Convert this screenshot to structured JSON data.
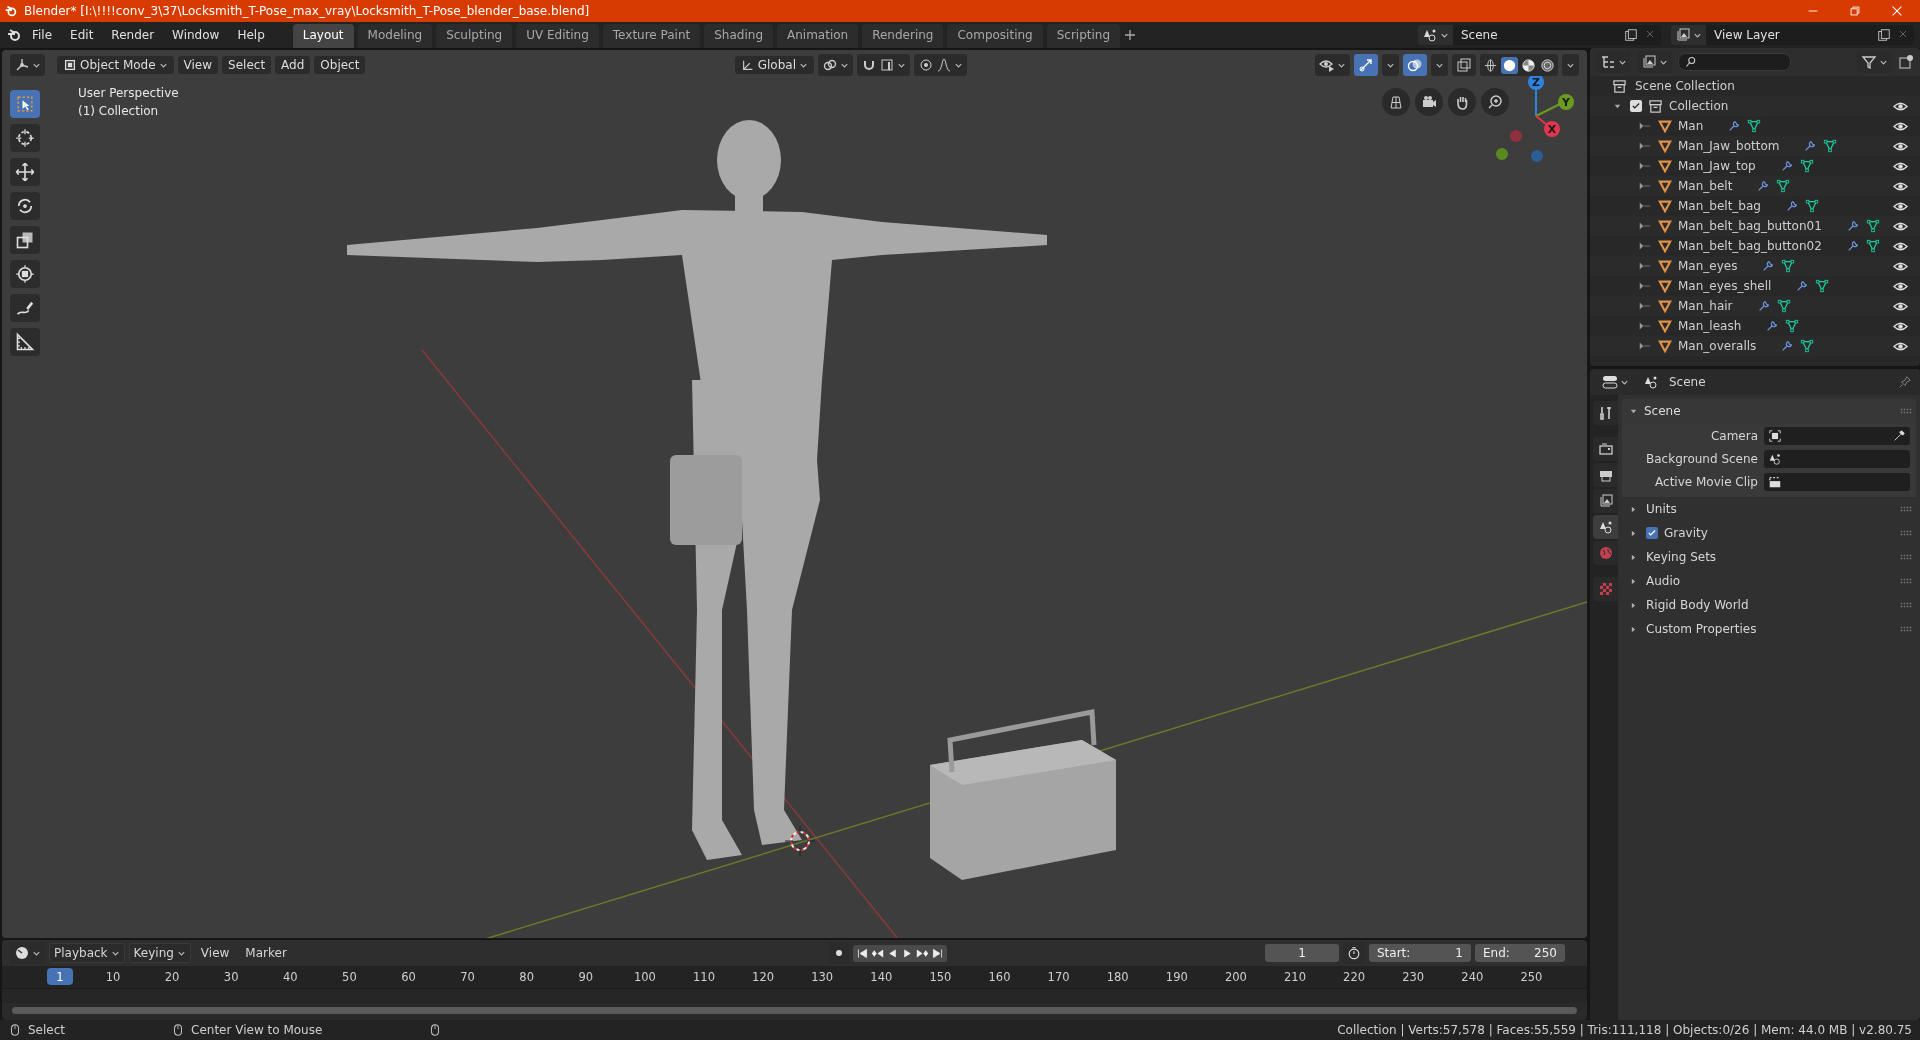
{
  "window": {
    "title": "Blender* [I:\\!!!!conv_3\\37\\Locksmith_T-Pose_max_vray\\Locksmith_T-Pose_blender_base.blend]"
  },
  "menu": [
    "File",
    "Edit",
    "Render",
    "Window",
    "Help"
  ],
  "workspaces": [
    {
      "label": "Layout",
      "selected": true
    },
    {
      "label": "Modeling",
      "selected": false
    },
    {
      "label": "Sculpting",
      "selected": false
    },
    {
      "label": "UV Editing",
      "selected": false
    },
    {
      "label": "Texture Paint",
      "selected": false
    },
    {
      "label": "Shading",
      "selected": false
    },
    {
      "label": "Animation",
      "selected": false
    },
    {
      "label": "Rendering",
      "selected": false
    },
    {
      "label": "Compositing",
      "selected": false
    },
    {
      "label": "Scripting",
      "selected": false
    }
  ],
  "scene_selector": {
    "value": "Scene"
  },
  "view_layer_selector": {
    "value": "View Layer"
  },
  "viewport": {
    "mode": "Object Mode",
    "menus": [
      "View",
      "Select",
      "Add",
      "Object"
    ],
    "orientation": "Global",
    "overlay_text": [
      "User Perspective",
      "(1) Collection"
    ],
    "tools": [
      {
        "kind": "select",
        "selected": true
      },
      {
        "kind": "cursor",
        "selected": false
      },
      {
        "kind": "move",
        "selected": false
      },
      {
        "kind": "rotate",
        "selected": false
      },
      {
        "kind": "scale",
        "selected": false
      },
      {
        "kind": "transform",
        "selected": false
      },
      {
        "kind": "annotate",
        "selected": false
      },
      {
        "kind": "measure",
        "selected": false
      }
    ],
    "shading": [
      {
        "kind": "wireframe",
        "selected": false
      },
      {
        "kind": "solid",
        "selected": true
      },
      {
        "kind": "material",
        "selected": false
      },
      {
        "kind": "rendered",
        "selected": false
      }
    ],
    "gizmo_axes": [
      {
        "label": "Z",
        "color": "#2f83e0"
      },
      {
        "label": "Y",
        "color": "#6a9a1e"
      },
      {
        "label": "X",
        "color": "#e0364f"
      }
    ]
  },
  "outliner": {
    "root": "Scene Collection",
    "collection": {
      "label": "Collection",
      "checked": true,
      "expanded": true,
      "children": [
        {
          "label": "Man"
        },
        {
          "label": "Man_Jaw_bottom"
        },
        {
          "label": "Man_Jaw_top"
        },
        {
          "label": "Man_belt"
        },
        {
          "label": "Man_belt_bag"
        },
        {
          "label": "Man_belt_bag_button01"
        },
        {
          "label": "Man_belt_bag_button02"
        },
        {
          "label": "Man_eyes"
        },
        {
          "label": "Man_eyes_shell"
        },
        {
          "label": "Man_hair"
        },
        {
          "label": "Man_leash"
        },
        {
          "label": "Man_overalls"
        }
      ]
    }
  },
  "properties": {
    "context": "Scene",
    "tabs": [
      {
        "kind": "tool",
        "selected": false
      },
      {
        "kind": "render",
        "selected": false
      },
      {
        "kind": "output",
        "selected": false
      },
      {
        "kind": "view_layer",
        "selected": false
      },
      {
        "kind": "scene",
        "selected": true
      },
      {
        "kind": "world",
        "selected": false
      },
      {
        "kind": "texture",
        "selected": false
      }
    ],
    "panel": {
      "title": "Scene",
      "expanded": true,
      "fields": [
        {
          "label": "Camera",
          "kind": "camera"
        },
        {
          "label": "Background Scene",
          "kind": "scene"
        },
        {
          "label": "Active Movie Clip",
          "kind": "clip"
        }
      ]
    },
    "subpanels": [
      {
        "title": "Units",
        "expanded": false
      },
      {
        "title": "Gravity",
        "expanded": false,
        "checked": true
      },
      {
        "title": "Keying Sets",
        "expanded": false
      },
      {
        "title": "Audio",
        "expanded": false
      },
      {
        "title": "Rigid Body World",
        "expanded": false
      },
      {
        "title": "Custom Properties",
        "expanded": false
      }
    ]
  },
  "timeline": {
    "menus": [
      {
        "label": "Playback",
        "kind": "dropdown"
      },
      {
        "label": "Keying",
        "kind": "dropdown"
      },
      {
        "label": "View",
        "kind": "menu"
      },
      {
        "label": "Marker",
        "kind": "menu"
      }
    ],
    "current_frame": "1",
    "start_label": "Start:",
    "start": "1",
    "end_label": "End:",
    "end": "250",
    "playhead": "1",
    "ticks": [
      "10",
      "20",
      "30",
      "40",
      "50",
      "60",
      "70",
      "80",
      "90",
      "100",
      "110",
      "120",
      "130",
      "140",
      "150",
      "160",
      "170",
      "180",
      "190",
      "200",
      "210",
      "220",
      "230",
      "240",
      "250"
    ]
  },
  "status_bar": {
    "hints": [
      "Select",
      "Center View to Mouse"
    ],
    "stats": "Collection | Verts:57,578 | Faces:55,559 | Tris:111,118 | Objects:0/26 | Mem: 44.0 MB | v2.80.75"
  }
}
